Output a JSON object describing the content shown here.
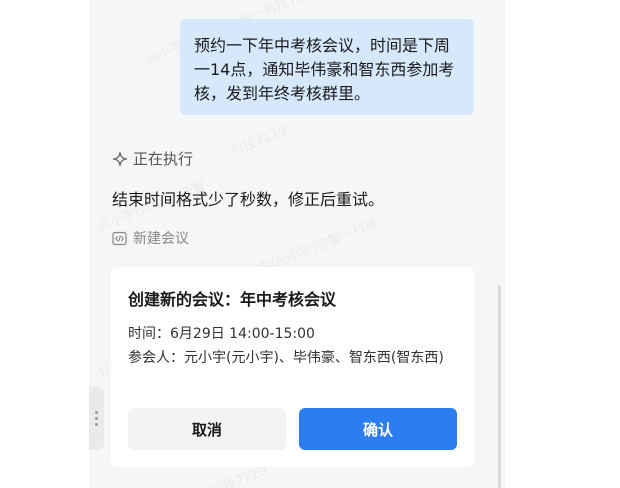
{
  "chat": {
    "user_message": "预约一下年中考核会议，时间是下周一14点，通知毕伟豪和智东西参加考核，发到年终考核群里。",
    "status_label": "正在执行",
    "assistant_message": "结束时间格式少了秒数，修正后重试。",
    "tool_label": "新建会议"
  },
  "card": {
    "title": "创建新的会议：年中考核会议",
    "time_line": "时间：6月29日 14:00-15:00",
    "attendees_line": "参会人：元小宇(元小宇)、毕伟豪、智东西(智东西)",
    "cancel_label": "取消",
    "confirm_label": "确认"
  },
  "colors": {
    "user_bubble": "#d5e8fc",
    "confirm_button": "#2b7df0",
    "panel_background": "#f5f6f7"
  },
  "icons": {
    "status": "sparkle-icon",
    "tool": "code-icon",
    "handle": "drag-handle-dots-icon"
  }
}
